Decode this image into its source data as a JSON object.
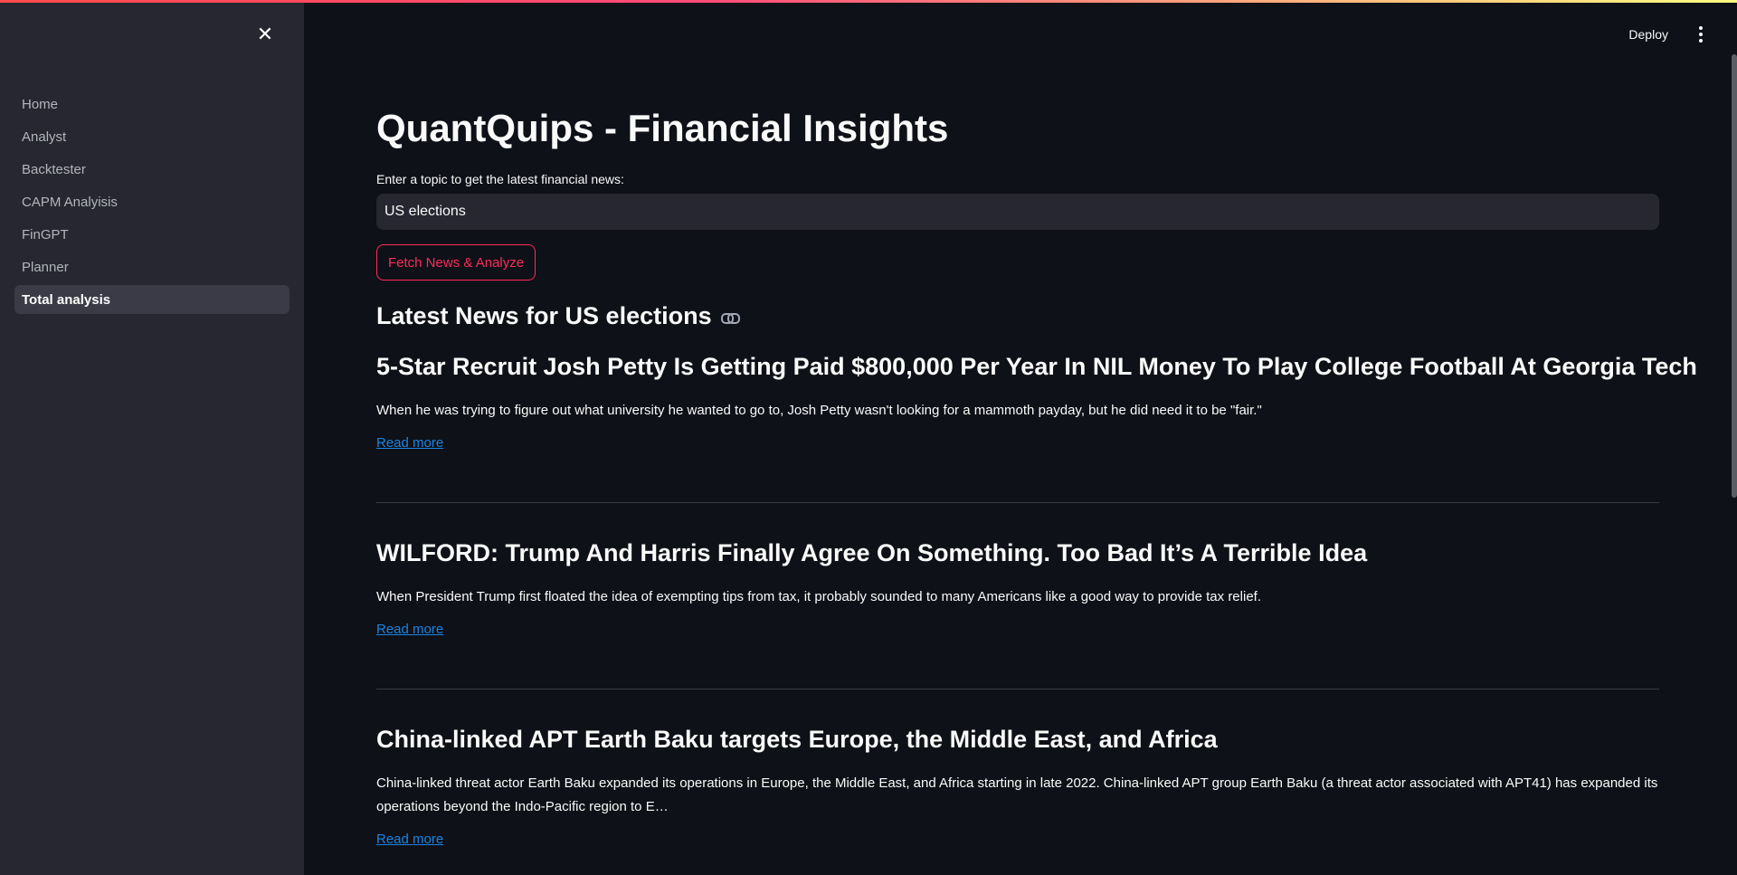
{
  "sidebar": {
    "close_icon": "close-icon",
    "items": [
      {
        "label": "Home"
      },
      {
        "label": "Analyst"
      },
      {
        "label": "Backtester"
      },
      {
        "label": "CAPM Analyisis"
      },
      {
        "label": "FinGPT"
      },
      {
        "label": "Planner"
      },
      {
        "label": "Total analysis",
        "active": true
      }
    ]
  },
  "header": {
    "deploy_label": "Deploy",
    "menu_icon": "kebab-menu-icon"
  },
  "main": {
    "title": "QuantQuips - Financial Insights",
    "input_label": "Enter a topic to get the latest financial news:",
    "input_value": "US elections",
    "fetch_button": "Fetch News & Analyze",
    "news_heading": "Latest News for US elections",
    "articles": [
      {
        "title": "5-Star Recruit Josh Petty Is Getting Paid $800,000 Per Year In NIL Money To Play College Football At Georgia Tech",
        "description": "When he was trying to figure out what university he wanted to go to, Josh Petty wasn't looking for a mammoth payday, but he did need it to be \"fair.\"",
        "link_label": "Read more"
      },
      {
        "title": "WILFORD: Trump And Harris Finally Agree On Something. Too Bad It’s A Terrible Idea",
        "description": "When President Trump first floated the idea of exempting tips from tax, it probably sounded to many Americans like a good way to provide tax relief.",
        "link_label": "Read more"
      },
      {
        "title": "China-linked APT Earth Baku targets Europe, the Middle East, and Africa",
        "description": "China-linked threat actor Earth Baku expanded its operations in Europe, the Middle East, and Africa starting in late 2022. China-linked APT group Earth Baku (a threat actor associated with APT41) has expanded its operations beyond the Indo-Pacific region to E…",
        "link_label": "Read more"
      }
    ]
  },
  "colors": {
    "background": "#0e1117",
    "sidebar": "#262730",
    "accent": "#ff2b5b",
    "link": "#1c83e1"
  }
}
